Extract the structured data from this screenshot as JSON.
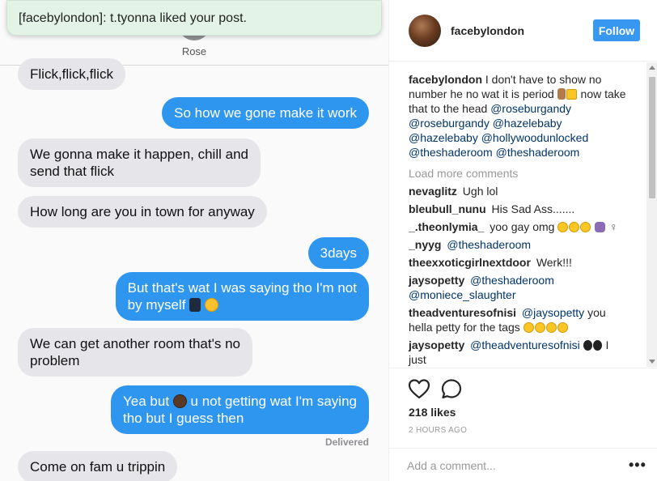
{
  "notification": {
    "text": "[facebylondon]: t.tyonna liked your post."
  },
  "chat": {
    "contact_name": "Rose",
    "messages": [
      {
        "dir": "in",
        "text": "Flick,flick,flick"
      },
      {
        "dir": "out",
        "text": "So how we gone make it work"
      },
      {
        "dir": "in",
        "line1": "We gonna make it happen, chill and",
        "line2": "send that flick"
      },
      {
        "dir": "in",
        "text": "How long are you in town for anyway"
      },
      {
        "dir": "out",
        "text": "3days"
      },
      {
        "dir": "out",
        "line1": "But that's wat I was saying tho I'm not",
        "line2": "by myself"
      },
      {
        "dir": "in",
        "line1": "We can get another room that's no",
        "line2": "problem"
      },
      {
        "dir": "out",
        "line1a": "Yea but",
        "line1b": "u not getting wat I'm saying",
        "line2": "tho but I guess then"
      },
      {
        "dir": "in",
        "text": "Come on fam u trippin"
      }
    ],
    "delivered": "Delivered"
  },
  "post": {
    "username": "facebylondon",
    "follow_label": "Follow",
    "caption": {
      "user": "facebylondon",
      "text1": "I don't have to show no number he no wat it is period",
      "text2": "now take that to the head",
      "mentions": [
        "@roseburgandy",
        "@roseburgandy",
        "@hazelebaby",
        "@hazelebaby",
        "@hollywoodunlocked",
        "@theshaderoom",
        "@theshaderoom"
      ]
    },
    "load_more": "Load more comments",
    "comments": [
      {
        "user": "nevaglitz",
        "text": "Ugh lol"
      },
      {
        "user": "bleubull_nunu",
        "text": "His Sad Ass......."
      },
      {
        "user": "_.theonlymia_",
        "text": "yoo gay omg"
      },
      {
        "user": "_nyyg",
        "mention": "@theshaderoom"
      },
      {
        "user": "theexxoticgirlnextdoor",
        "text": "Werk!!!"
      },
      {
        "user": "jaysopetty",
        "mention": "@theshaderoom",
        "mention2": "@moniece_slaughter"
      },
      {
        "user": "theadventuresofnisi",
        "mention": "@jaysopetty",
        "text": "you hella petty for the tags"
      },
      {
        "user": "jaysopetty",
        "mention": "@theadventuresofnisi",
        "text": "I just"
      }
    ],
    "likes": "218 likes",
    "time": "2 HOURS AGO",
    "comment_placeholder": "Add a comment...",
    "more_label": "•••"
  },
  "icons": [
    "heart-icon",
    "comment-icon",
    "more-options-icon"
  ],
  "colors": {
    "imessage_blue": "#2f96ef",
    "received_gray": "#e5e5ea",
    "follow_blue": "#3897f0"
  }
}
